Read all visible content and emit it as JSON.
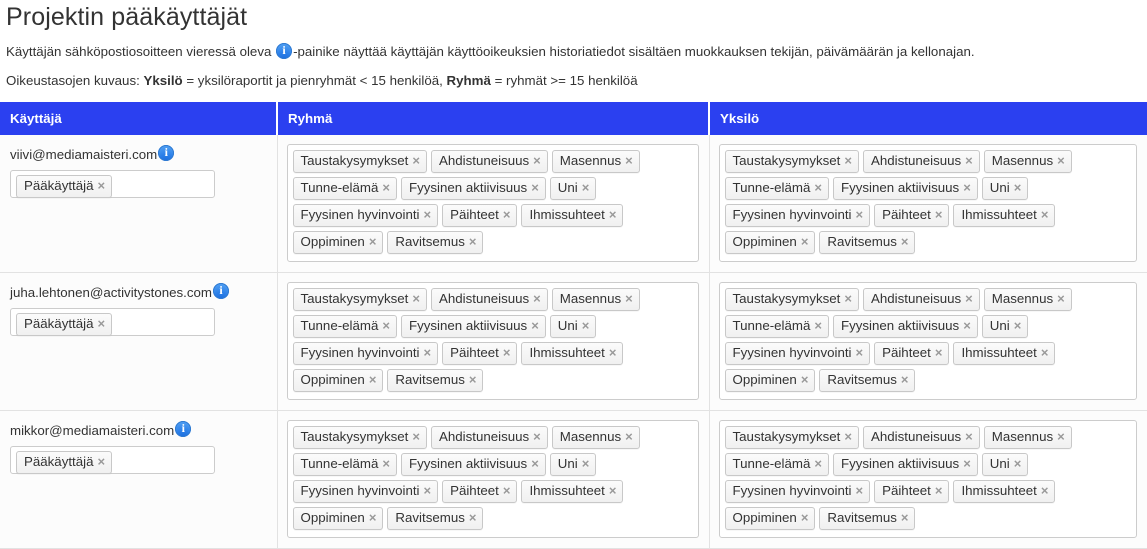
{
  "page": {
    "title": "Projektin pääkäyttäjät",
    "intro_1_before": "Käyttäjän sähköpostiosoitteen vieressä oleva ",
    "intro_1_after": "-painike näyttää käyttäjän käyttöoikeuksien historiatiedot sisältäen muokkauksen tekijän, päivämäärän ja kellonajan.",
    "intro_2_prefix": "Oikeustasojen kuvaus: ",
    "intro_2_bold_1": "Yksilö",
    "intro_2_mid": " = yksilöraportit ja pienryhmät < 15 henkilöä, ",
    "intro_2_bold_2": "Ryhmä",
    "intro_2_suffix": " = ryhmät >= 15 henkilöä",
    "info_icon_name": "info-icon"
  },
  "table": {
    "headers": {
      "user": "Käyttäjä",
      "group": "Ryhmä",
      "individual": "Yksilö"
    },
    "rows": [
      {
        "email": "viivi@mediamaisteri.com",
        "role_chips": [
          "Pääkäyttäjä"
        ],
        "group_tags": [
          [
            "Taustakysymykset",
            "Ahdistuneisuus",
            "Masennus"
          ],
          [
            "Tunne-elämä",
            "Fyysinen aktiivisuus",
            "Uni"
          ],
          [
            "Fyysinen hyvinvointi",
            "Päihteet",
            "Ihmissuhteet"
          ],
          [
            "Oppiminen",
            "Ravitsemus"
          ]
        ],
        "individual_tags": [
          [
            "Taustakysymykset",
            "Ahdistuneisuus",
            "Masennus"
          ],
          [
            "Tunne-elämä",
            "Fyysinen aktiivisuus",
            "Uni"
          ],
          [
            "Fyysinen hyvinvointi",
            "Päihteet",
            "Ihmissuhteet"
          ],
          [
            "Oppiminen",
            "Ravitsemus"
          ]
        ]
      },
      {
        "email": "juha.lehtonen@activitystones.com",
        "role_chips": [
          "Pääkäyttäjä"
        ],
        "group_tags": [
          [
            "Taustakysymykset",
            "Ahdistuneisuus",
            "Masennus"
          ],
          [
            "Tunne-elämä",
            "Fyysinen aktiivisuus",
            "Uni"
          ],
          [
            "Fyysinen hyvinvointi",
            "Päihteet",
            "Ihmissuhteet"
          ],
          [
            "Oppiminen",
            "Ravitsemus"
          ]
        ],
        "individual_tags": [
          [
            "Taustakysymykset",
            "Ahdistuneisuus",
            "Masennus"
          ],
          [
            "Tunne-elämä",
            "Fyysinen aktiivisuus",
            "Uni"
          ],
          [
            "Fyysinen hyvinvointi",
            "Päihteet",
            "Ihmissuhteet"
          ],
          [
            "Oppiminen",
            "Ravitsemus"
          ]
        ]
      },
      {
        "email": "mikkor@mediamaisteri.com",
        "role_chips": [
          "Pääkäyttäjä"
        ],
        "group_tags": [
          [
            "Taustakysymykset",
            "Ahdistuneisuus",
            "Masennus"
          ],
          [
            "Tunne-elämä",
            "Fyysinen aktiivisuus",
            "Uni"
          ],
          [
            "Fyysinen hyvinvointi",
            "Päihteet",
            "Ihmissuhteet"
          ],
          [
            "Oppiminen",
            "Ravitsemus"
          ]
        ],
        "individual_tags": [
          [
            "Taustakysymykset",
            "Ahdistuneisuus",
            "Masennus"
          ],
          [
            "Tunne-elämä",
            "Fyysinen aktiivisuus",
            "Uni"
          ],
          [
            "Fyysinen hyvinvointi",
            "Päihteet",
            "Ihmissuhteet"
          ],
          [
            "Oppiminen",
            "Ravitsemus"
          ]
        ]
      }
    ],
    "chip_remove_glyph": "×"
  },
  "colors": {
    "header_blue": "#2b40f0",
    "info_blue": "#2b7fe8",
    "text": "#333333",
    "chip_border": "#c8c8c8",
    "row_border": "#e2e2e2"
  }
}
